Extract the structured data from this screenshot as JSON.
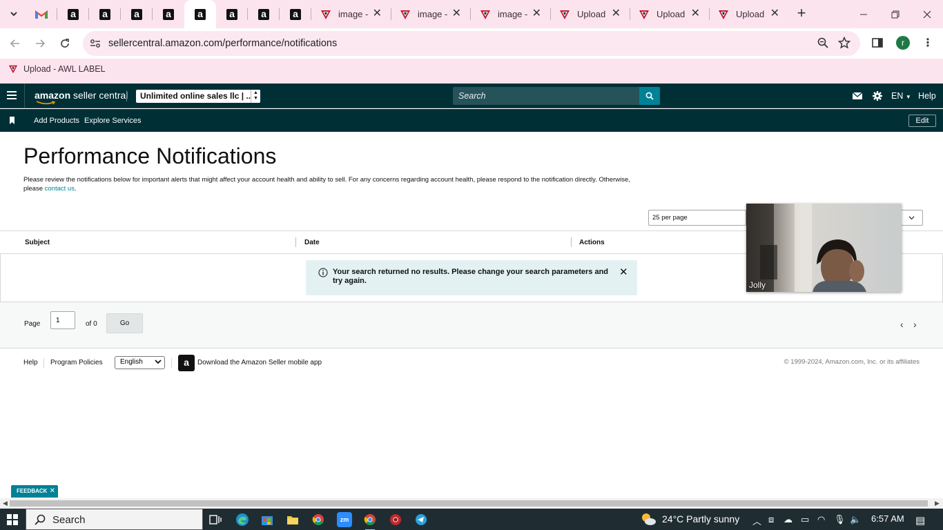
{
  "browser": {
    "tabs": [
      {
        "title": "",
        "icon": "gmail-icon"
      },
      {
        "title": "",
        "icon": "amazon-icon"
      },
      {
        "title": "",
        "icon": "amazon-icon"
      },
      {
        "title": "",
        "icon": "amazon-icon"
      },
      {
        "title": "",
        "icon": "amazon-icon"
      },
      {
        "title": "",
        "icon": "amazon-icon",
        "active": true
      },
      {
        "title": "",
        "icon": "amazon-icon"
      },
      {
        "title": "",
        "icon": "amazon-icon"
      },
      {
        "title": "",
        "icon": "amazon-icon"
      },
      {
        "title": "image -",
        "icon": "awl-icon"
      },
      {
        "title": "image -",
        "icon": "awl-icon"
      },
      {
        "title": "image -",
        "icon": "awl-icon"
      },
      {
        "title": "Upload",
        "icon": "awl-icon"
      },
      {
        "title": "Upload",
        "icon": "awl-icon"
      },
      {
        "title": "Upload",
        "icon": "awl-icon"
      }
    ],
    "url": "sellercentral.amazon.com/performance/notifications",
    "profile_initial": "r",
    "bookmark_label": "Upload - AWL LABEL"
  },
  "header": {
    "logo_bold": "amazon",
    "logo_rest": " seller central",
    "account": "Unlimited online sales llc | ...",
    "search_placeholder": "Search",
    "language": "EN",
    "help": "Help",
    "nav_links": [
      "Add Products",
      "Explore Services"
    ],
    "edit": "Edit"
  },
  "page": {
    "title": "Performance Notifications",
    "description": "Please review the notifications below for important alerts that might affect your account health and ability to sell. For any concerns regarding account health, please respond to the notification directly. Otherwise, please ",
    "contact_link": "contact us",
    "description_end": ".",
    "per_page": "25 per page",
    "columns": [
      "Subject",
      "Date",
      "Actions"
    ],
    "alert": "Your search returned no results. Please change your search parameters and try again.",
    "pager": {
      "page_label": "Page",
      "page_value": "1",
      "of_label": "of 0",
      "go": "Go"
    }
  },
  "footer": {
    "help": "Help",
    "program_policies": "Program Policies",
    "language": "English",
    "app_text": "Download the Amazon Seller mobile app",
    "copyright": "© 1999-2024, Amazon.com, Inc. or its affiliates"
  },
  "video": {
    "name": "Jolly"
  },
  "feedback": "FEEDBACK",
  "taskbar": {
    "search": "Search",
    "weather": "24°C  Partly sunny",
    "time": "6:57 AM"
  },
  "colors": {
    "sc_header": "#002f36",
    "sc_accent": "#008296",
    "tab_strip": "#fce4ef"
  }
}
